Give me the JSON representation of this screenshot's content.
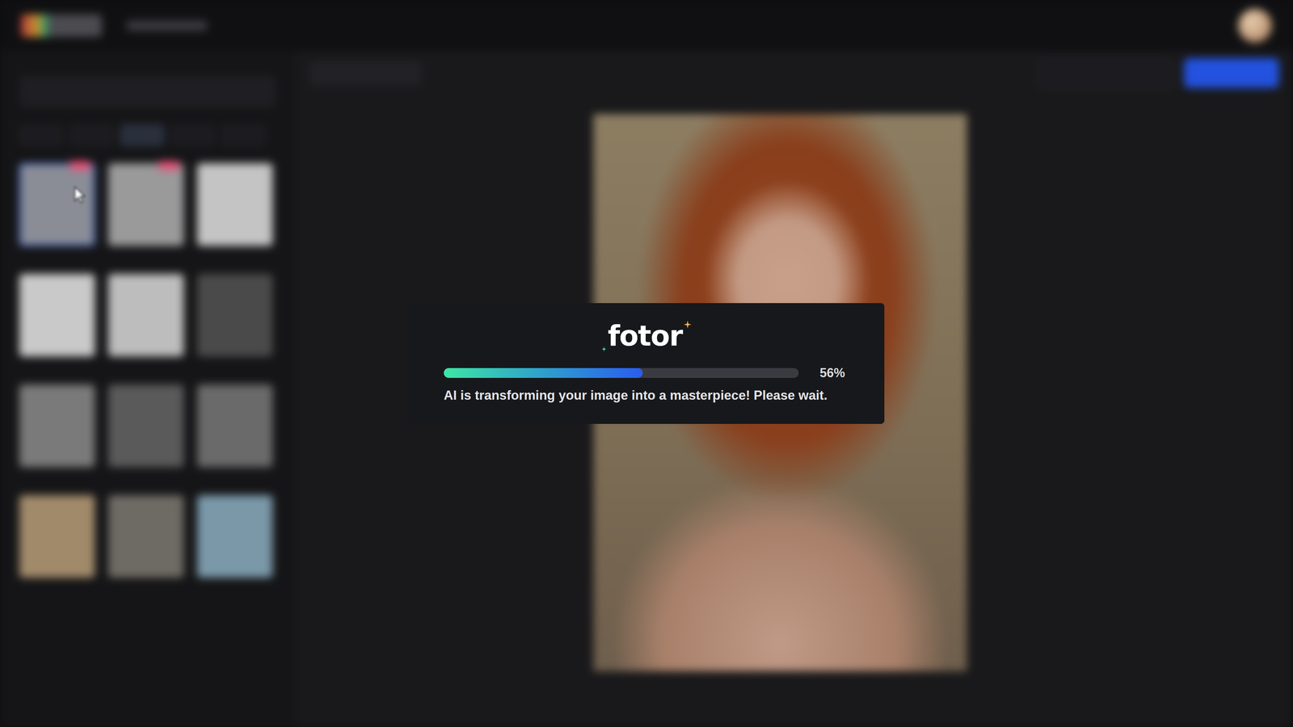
{
  "modal": {
    "logo": "fotor",
    "progress": {
      "level": 0.56,
      "reading": "56%"
    },
    "message": "AI is transforming your image into a masterpiece! Please wait."
  },
  "sidebar": {
    "tabs": [
      {
        "selected": false
      },
      {
        "selected": false
      },
      {
        "selected": true
      },
      {
        "selected": false
      },
      {
        "selected": false
      }
    ],
    "effects": [
      {
        "selected": true,
        "new": true,
        "color": "#8a8d96"
      },
      {
        "selected": false,
        "new": true,
        "color": "#9a9a9a"
      },
      {
        "selected": false,
        "new": false,
        "color": "#c4c4c4"
      },
      {
        "selected": false,
        "new": false,
        "color": "#c9c9c9"
      },
      {
        "selected": false,
        "new": false,
        "color": "#bdbdbd"
      },
      {
        "selected": false,
        "new": false,
        "color": "#4a4a4a"
      },
      {
        "selected": false,
        "new": false,
        "color": "#7a7a7a"
      },
      {
        "selected": false,
        "new": false,
        "color": "#5a5a5a"
      },
      {
        "selected": false,
        "new": false,
        "color": "#6a6a6a"
      },
      {
        "selected": false,
        "new": false,
        "color": "#a08a6a"
      },
      {
        "selected": false,
        "new": false,
        "color": "#6e6a64"
      },
      {
        "selected": false,
        "new": false,
        "color": "#7a98a8"
      }
    ]
  }
}
